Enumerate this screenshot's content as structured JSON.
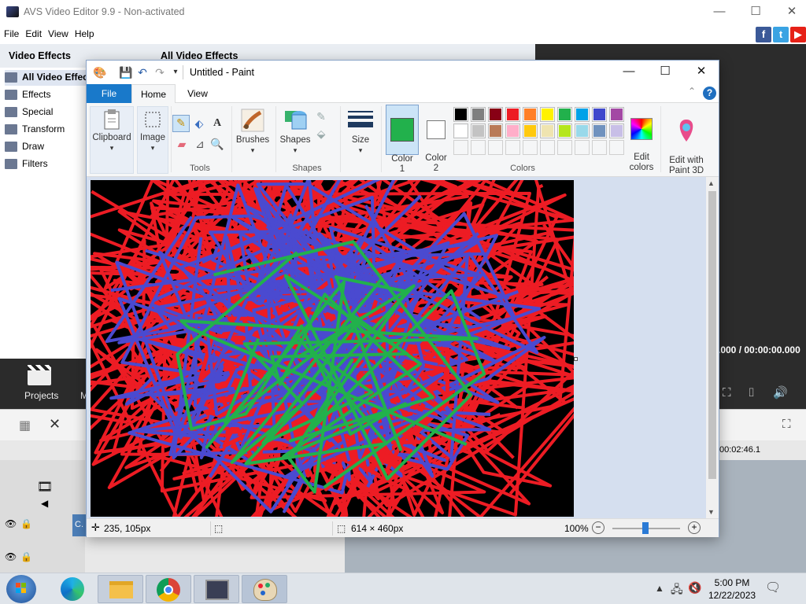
{
  "avs": {
    "title": "AVS Video Editor 9.9 - Non-activated",
    "menu": [
      "File",
      "Edit",
      "View",
      "Help"
    ],
    "left_header": "Video Effects",
    "tree": [
      "All Video Effects",
      "Effects",
      "Special",
      "Transform",
      "Draw",
      "Filters"
    ],
    "mid_header": "All Video Effects",
    "time_display": ".000 / 00:00:00.000",
    "projects_label": "Projects",
    "more_label": "M",
    "ruler_time": "00:02:46.1",
    "clip_label": "C."
  },
  "paint": {
    "title": "Untitled - Paint",
    "tabs": {
      "file": "File",
      "home": "Home",
      "view": "View"
    },
    "groups": {
      "clipboard": "Clipboard",
      "image": "Image",
      "tools": "Tools",
      "brushes": "Brushes",
      "shapes_btn": "Shapes",
      "shapes_group": "Shapes",
      "size": "Size",
      "color1": "Color\n1",
      "color2": "Color\n2",
      "colors": "Colors",
      "edit_colors": "Edit\ncolors",
      "paint3d": "Edit with\nPaint 3D"
    },
    "palette_row1": [
      "#000000",
      "#7f7f7f",
      "#880015",
      "#ed1c24",
      "#ff7f27",
      "#fff200",
      "#22b14c",
      "#00a2e8",
      "#3f48cc",
      "#a349a4"
    ],
    "palette_row2": [
      "#ffffff",
      "#c3c3c3",
      "#b97a57",
      "#ffaec9",
      "#ffc90e",
      "#efe4b0",
      "#b5e61d",
      "#99d9ea",
      "#7092be",
      "#c8bfe7"
    ],
    "color1": "#22b14c",
    "color2": "#ffffff",
    "status": {
      "cursor_pos": "235, 105px",
      "image_size": "614 × 460px",
      "zoom": "100%"
    }
  },
  "taskbar": {
    "time": "5:00 PM",
    "date": "12/22/2023",
    "apps": [
      "start-button",
      "edge-icon",
      "file-explorer-icon",
      "chrome-icon",
      "avs-editor-icon",
      "paint-icon"
    ]
  }
}
